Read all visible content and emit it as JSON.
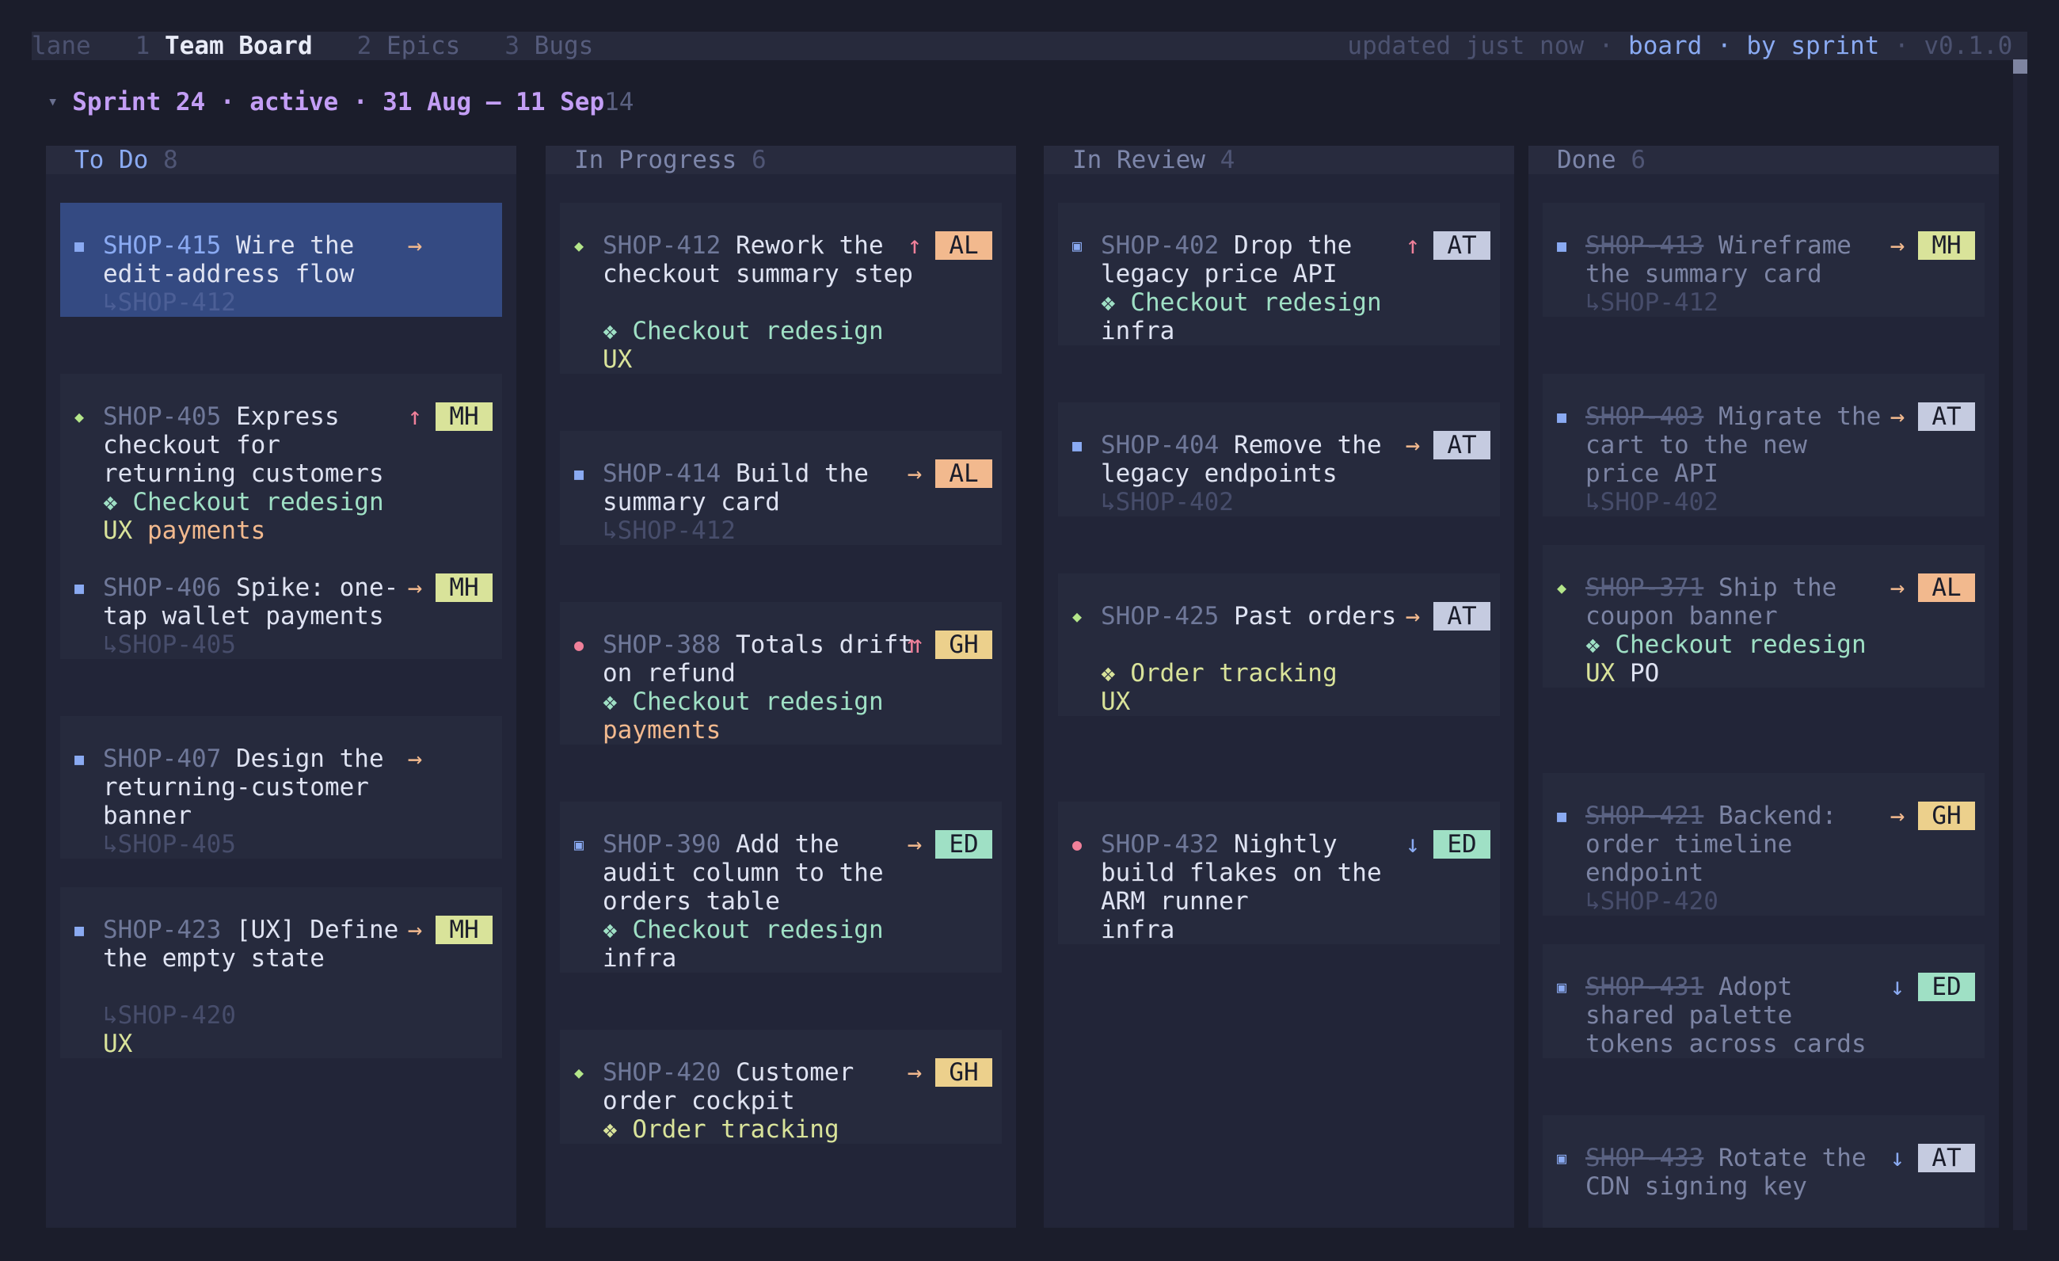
{
  "topbar": {
    "app": "lane",
    "tabs": [
      {
        "num": "1",
        "label": "Team Board",
        "active": true
      },
      {
        "num": "2",
        "label": "Epics",
        "active": false
      },
      {
        "num": "3",
        "label": "Bugs",
        "active": false
      }
    ],
    "status": "updated just now",
    "sep": " · ",
    "view": "board",
    "grouping": "by sprint",
    "version": "v0.1.0"
  },
  "sprint": {
    "caret": "▾",
    "title": "Sprint 24 · active · 31 Aug – 11 Sep",
    "count": "14"
  },
  "columns": [
    {
      "title": "To Do",
      "count": "8",
      "cards": [
        {
          "type": "task",
          "key": "SHOP-415",
          "lines": [
            "Wire the",
            "edit-address flow"
          ],
          "prio": "medium",
          "parent": "↳SHOP-412",
          "selected": true
        },
        {
          "type": "feature",
          "key": "SHOP-405",
          "lines": [
            "Express",
            "checkout for",
            "returning customers"
          ],
          "prio": "high",
          "assignee": "MH",
          "epic": "❖ Checkout redesign",
          "labels": [
            "UX",
            "payments"
          ]
        },
        {
          "type": "task",
          "key": "SHOP-406",
          "lines": [
            "Spike: one-",
            "tap wallet payments"
          ],
          "prio": "medium",
          "assignee": "MH",
          "parent": "↳SHOP-405"
        },
        {
          "type": "task",
          "key": "SHOP-407",
          "lines": [
            "Design the",
            "returning-customer",
            "banner"
          ],
          "prio": "medium",
          "parent": "↳SHOP-405"
        },
        {
          "type": "task",
          "key": "SHOP-423",
          "lines": [
            "[UX] Define",
            "the empty state"
          ],
          "prio": "medium",
          "assignee": "MH",
          "parent": "↳SHOP-420",
          "labels": [
            "UX"
          ]
        }
      ]
    },
    {
      "title": "In Progress",
      "count": "6",
      "cards": [
        {
          "type": "feature",
          "key": "SHOP-412",
          "lines": [
            "Rework the",
            "checkout summary step"
          ],
          "prio": "high",
          "assignee": "AL",
          "epic": "❖ Checkout redesign",
          "labels": [
            "UX"
          ]
        },
        {
          "type": "task",
          "key": "SHOP-414",
          "lines": [
            "Build the",
            "summary card"
          ],
          "prio": "medium",
          "assignee": "AL",
          "parent": "↳SHOP-412"
        },
        {
          "type": "bug",
          "key": "SHOP-388",
          "lines": [
            "Totals drift",
            "on refund"
          ],
          "prio": "highest",
          "assignee": "GH",
          "epic": "❖ Checkout redesign",
          "labels": [
            "payments"
          ]
        },
        {
          "type": "story",
          "key": "SHOP-390",
          "lines": [
            "Add the",
            "audit column to the",
            "orders table"
          ],
          "prio": "medium",
          "assignee": "ED",
          "epic": "❖ Checkout redesign",
          "labels": [
            "infra"
          ]
        },
        {
          "type": "feature",
          "key": "SHOP-420",
          "lines": [
            "Customer",
            "order cockpit"
          ],
          "prio": "medium",
          "assignee": "GH",
          "epic": "❖ Order tracking"
        }
      ]
    },
    {
      "title": "In Review",
      "count": "4",
      "cards": [
        {
          "type": "story",
          "key": "SHOP-402",
          "lines": [
            "Drop the",
            "legacy price API"
          ],
          "prio": "high",
          "assignee": "AT",
          "epic": "❖ Checkout redesign",
          "labels": [
            "infra"
          ]
        },
        {
          "type": "task",
          "key": "SHOP-404",
          "lines": [
            "Remove the",
            "legacy endpoints"
          ],
          "prio": "medium",
          "assignee": "AT",
          "parent": "↳SHOP-402"
        },
        {
          "type": "feature",
          "key": "SHOP-425",
          "lines": [
            "Past orders"
          ],
          "prio": "medium",
          "assignee": "AT",
          "epic": "❖ Order tracking",
          "labels": [
            "UX"
          ]
        },
        {
          "type": "bug",
          "key": "SHOP-432",
          "lines": [
            "Nightly",
            "build flakes on the",
            "ARM runner"
          ],
          "prio": "low",
          "assignee": "ED",
          "labels": [
            "infra"
          ]
        }
      ]
    },
    {
      "title": "Done",
      "count": "6",
      "cards": [
        {
          "type": "task",
          "key": "SHOP-413",
          "lines": [
            "Wireframe",
            "the summary card"
          ],
          "prio": "medium",
          "assignee": "MH",
          "parent": "↳SHOP-412"
        },
        {
          "type": "task",
          "key": "SHOP-403",
          "lines": [
            "Migrate the",
            "cart to the new",
            "price API"
          ],
          "prio": "medium",
          "assignee": "AT",
          "parent": "↳SHOP-402"
        },
        {
          "type": "feature",
          "key": "SHOP-371",
          "lines": [
            "Ship the",
            "coupon banner"
          ],
          "prio": "medium",
          "assignee": "AL",
          "epic": "❖ Checkout redesign",
          "labels": [
            "UX",
            "PO"
          ]
        },
        {
          "type": "task",
          "key": "SHOP-421",
          "lines": [
            "Backend:",
            "order timeline",
            "endpoint"
          ],
          "prio": "medium",
          "assignee": "GH",
          "parent": "↳SHOP-420"
        },
        {
          "type": "story",
          "key": "SHOP-431",
          "lines": [
            "Adopt",
            "shared palette",
            "tokens across cards"
          ],
          "prio": "low",
          "assignee": "ED"
        },
        {
          "type": "story",
          "key": "SHOP-433",
          "lines": [
            "Rotate the",
            "CDN signing key"
          ],
          "prio": "low",
          "assignee": "AT"
        }
      ]
    }
  ],
  "glyphs": {
    "task": "■",
    "story": "▣",
    "feature": "◆",
    "bug": "●"
  },
  "priority_icons": {
    "highest": "⇈",
    "high": "↑",
    "medium": "→",
    "low": "↓"
  },
  "assignee_colors": {
    "AL": "#f2b98e",
    "MH": "#d9e39a",
    "AT": "#c5cbe0",
    "GH": "#ecd08c",
    "ED": "#9fe0c5"
  },
  "colors": {
    "background": "#1b1d2b",
    "accent": "#8aaaf2",
    "sprint": "#c39ef5",
    "selected": "#344a82"
  }
}
